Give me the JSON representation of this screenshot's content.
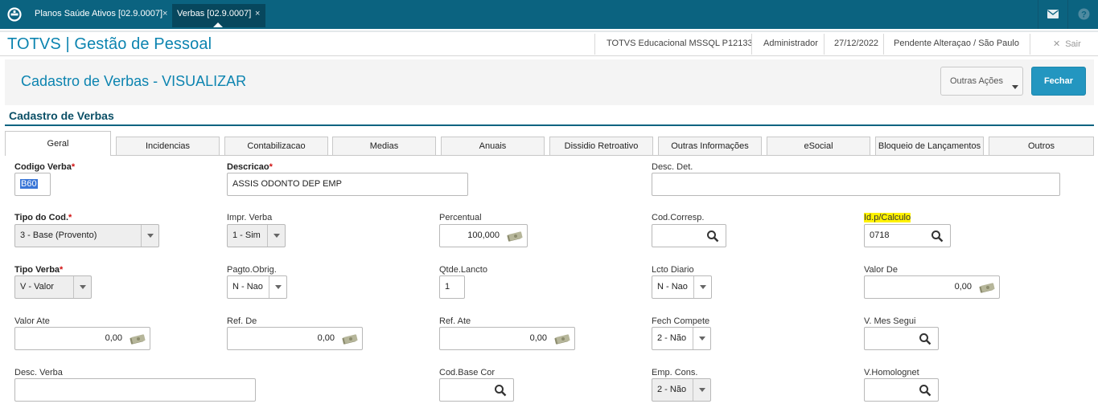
{
  "topbar": {
    "tabs": [
      {
        "label": "Planos Saúde Ativos [02.9.0007]",
        "close": "×"
      },
      {
        "label": "Verbas [02.9.0007]",
        "close": "×"
      }
    ],
    "icons": [
      "totvs-logo-icon",
      "mail-icon",
      "help-icon"
    ]
  },
  "app": {
    "title": "TOTVS | Gestão de Pessoal",
    "environment": "TOTVS Educacional MSSQL P12133",
    "user": "Administrador",
    "date": "27/12/2022",
    "status": "Pendente Alteraçao / São Paulo",
    "exit_label": "Sair"
  },
  "page": {
    "title": "Cadastro de Verbas - VISUALIZAR",
    "other_actions_label": "Outras Ações",
    "close_label": "Fechar",
    "section_title": "Cadastro de Verbas"
  },
  "tabs": [
    "Geral",
    "Incidencias",
    "Contabilizacao",
    "Medias",
    "Anuais",
    "Dissidio Retroativo",
    "Outras Informações",
    "eSocial",
    "Bloqueio de Lançamentos",
    "Outros"
  ],
  "form": {
    "codigo_verba": {
      "label": "Codigo Verba",
      "required": "*",
      "value": "B60"
    },
    "descricao": {
      "label": "Descricao",
      "required": "*",
      "value": "ASSIS ODONTO DEP EMP"
    },
    "desc_det": {
      "label": "Desc. Det.",
      "value": ""
    },
    "tipo_cod": {
      "label": "Tipo do Cod.",
      "required": "*",
      "value": "3 - Base (Provento)"
    },
    "impr_verba": {
      "label": "Impr. Verba",
      "value": "1 - Sim"
    },
    "percentual": {
      "label": "Percentual",
      "value": "100,000"
    },
    "cod_corresp": {
      "label": "Cod.Corresp.",
      "value": ""
    },
    "id_calculo": {
      "label": "Id.p/Calculo",
      "value": "0718"
    },
    "tipo_verba": {
      "label": "Tipo Verba",
      "required": "*",
      "value": "V - Valor"
    },
    "pagto_obrig": {
      "label": "Pagto.Obrig.",
      "value": "N - Nao"
    },
    "qtde_lancto": {
      "label": "Qtde.Lancto",
      "value": "1"
    },
    "lcto_diario": {
      "label": "Lcto Diario",
      "value": "N - Nao"
    },
    "valor_de": {
      "label": "Valor De",
      "value": "0,00"
    },
    "valor_ate": {
      "label": "Valor Ate",
      "value": "0,00"
    },
    "ref_de": {
      "label": "Ref. De",
      "value": "0,00"
    },
    "ref_ate": {
      "label": "Ref. Ate",
      "value": "0,00"
    },
    "fech_compete": {
      "label": "Fech Compete",
      "value": "2 - Não"
    },
    "v_mes_segui": {
      "label": "V. Mes Segui",
      "value": ""
    },
    "desc_verba": {
      "label": "Desc. Verba",
      "value": ""
    },
    "cod_base_cor": {
      "label": "Cod.Base Cor",
      "value": ""
    },
    "emp_cons": {
      "label": "Emp. Cons.",
      "value": "2 - Não"
    },
    "v_homolognet": {
      "label": "V.Homolognet",
      "value": ""
    }
  }
}
